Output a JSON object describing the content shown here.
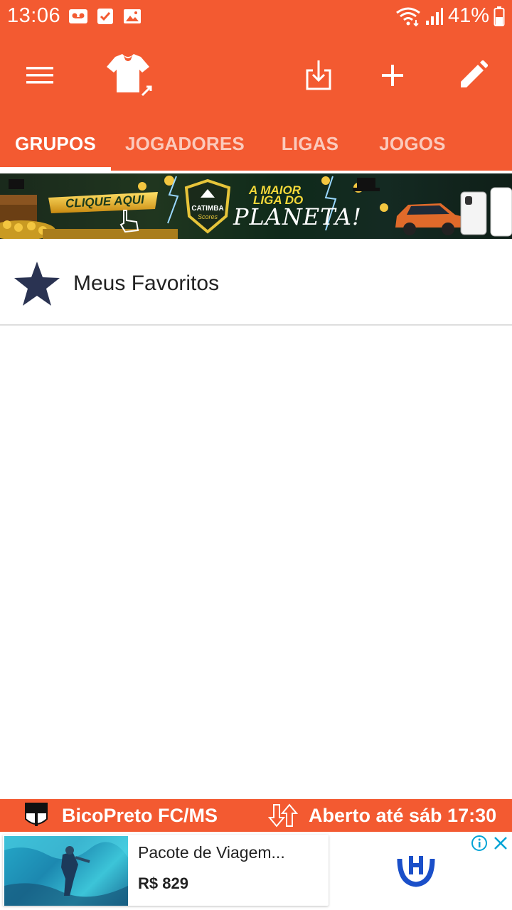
{
  "status_bar": {
    "time": "13:06",
    "battery": "41%"
  },
  "toolbar": {
    "menu_icon": "hamburger-menu-icon",
    "shirt_icon": "team-shirt-icon",
    "import_icon": "download-import-icon",
    "add_icon": "plus-icon",
    "edit_icon": "pencil-icon"
  },
  "tabs": [
    {
      "label": "GRUPOS",
      "active": true
    },
    {
      "label": "JOGADORES",
      "active": false
    },
    {
      "label": "LIGAS",
      "active": false
    },
    {
      "label": "JOGOS",
      "active": false
    }
  ],
  "banner": {
    "cta": "CLIQUE AQUI",
    "brand_line1": "CATIMBA",
    "brand_line2": "Scores",
    "headline_1": "A MAIOR",
    "headline_2": "LIGA DO",
    "headline_3": "PLANETA!"
  },
  "favorites": {
    "label": "Meus Favoritos"
  },
  "team_bar": {
    "team_name": "BicoPreto FC/MS",
    "market_status": "Aberto  até sáb 17:30"
  },
  "ad": {
    "title": "Pacote de Viagem...",
    "price": "R$ 829"
  },
  "colors": {
    "primary": "#F35A31",
    "star": "#2A3352",
    "ad_logo": "#1A4FC9"
  }
}
